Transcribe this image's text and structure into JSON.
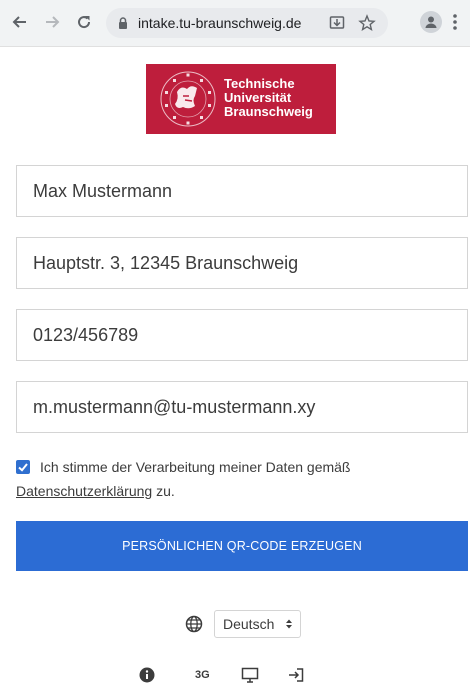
{
  "browser": {
    "url": "intake.tu-braunschweig.de",
    "back_icon": "arrow-left-icon",
    "forward_icon": "arrow-right-icon",
    "reload_icon": "reload-icon",
    "lock_icon": "lock-icon",
    "download_icon": "download-icon",
    "star_icon": "star-icon",
    "profile_icon": "profile-icon",
    "menu_icon": "more-vert-icon"
  },
  "logo": {
    "line1": "Technische",
    "line2": "Universität",
    "line3": "Braunschweig",
    "seal_text": "CAROLO-WILHELMINA BRAUNSCHWEIG",
    "color": "#be1e3c"
  },
  "form": {
    "name_value": "Max Mustermann",
    "address_value": "Hauptstr. 3, 12345 Braunschweig",
    "phone_value": "0123/456789",
    "email_value": "m.mustermann@tu-mustermann.xy"
  },
  "consent": {
    "checked": true,
    "text_before": "Ich stimme der Verarbeitung meiner Daten gemäß",
    "link_text": "Datenschutzerklärung",
    "text_after": " zu."
  },
  "qr_button": {
    "label": "PERSÖNLICHEN QR-CODE ERZEUGEN",
    "color": "#2c6cd4"
  },
  "language": {
    "globe_icon": "globe-icon",
    "selected": "Deutsch"
  },
  "bottom_icons": {
    "info_icon": "info-icon",
    "three_g_label": "3G",
    "display_icon": "display-icon",
    "login_icon": "login-icon"
  }
}
